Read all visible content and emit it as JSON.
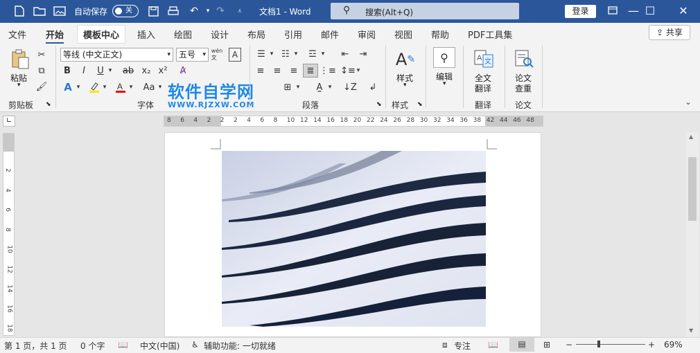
{
  "titlebar": {
    "autosave_label": "自动保存",
    "autosave_state": "关",
    "doc_title": "文档1  -  Word",
    "search_placeholder": "搜索(Alt+Q)",
    "login_label": "登录"
  },
  "tabs": [
    "文件",
    "开始",
    "模板中心",
    "插入",
    "绘图",
    "设计",
    "布局",
    "引用",
    "邮件",
    "审阅",
    "视图",
    "帮助",
    "PDF工具集"
  ],
  "share_label": "共享",
  "ribbon": {
    "paste_label": "粘贴",
    "font_name": "等线 (中文正文)",
    "font_size": "五号",
    "groups": {
      "clipboard": "剪贴板",
      "font": "字体",
      "paragraph": "段落",
      "styles": "样式",
      "translate": "翻译",
      "thesis": "论文"
    },
    "styles_label": "样式",
    "edit_label": "编辑",
    "translate_label_1": "全文",
    "translate_label_2": "翻译",
    "thesis_label_1": "论文",
    "thesis_label_2": "查重"
  },
  "watermark": {
    "title": "软件自学网",
    "url": "WWW.RJZXW.COM"
  },
  "ruler": {
    "ticks": [
      "8",
      "6",
      "4",
      "2",
      "2",
      "2",
      "4",
      "6",
      "8",
      "10",
      "12",
      "14",
      "16",
      "18",
      "20",
      "22",
      "24",
      "26",
      "28",
      "30",
      "32",
      "34",
      "36",
      "38",
      "42",
      "44",
      "46",
      "48"
    ],
    "vticks": [
      "2",
      "4",
      "6",
      "8",
      "10",
      "12",
      "14",
      "16",
      "18"
    ]
  },
  "statusbar": {
    "page": "第 1 页，共 1 页",
    "words": "0 个字",
    "language": "中文(中国)",
    "accessibility": "辅助功能: 一切就绪",
    "focus": "专注",
    "zoom": "69%"
  },
  "colors": {
    "accent": "#2b579a",
    "watermark": "#1e88e5"
  }
}
